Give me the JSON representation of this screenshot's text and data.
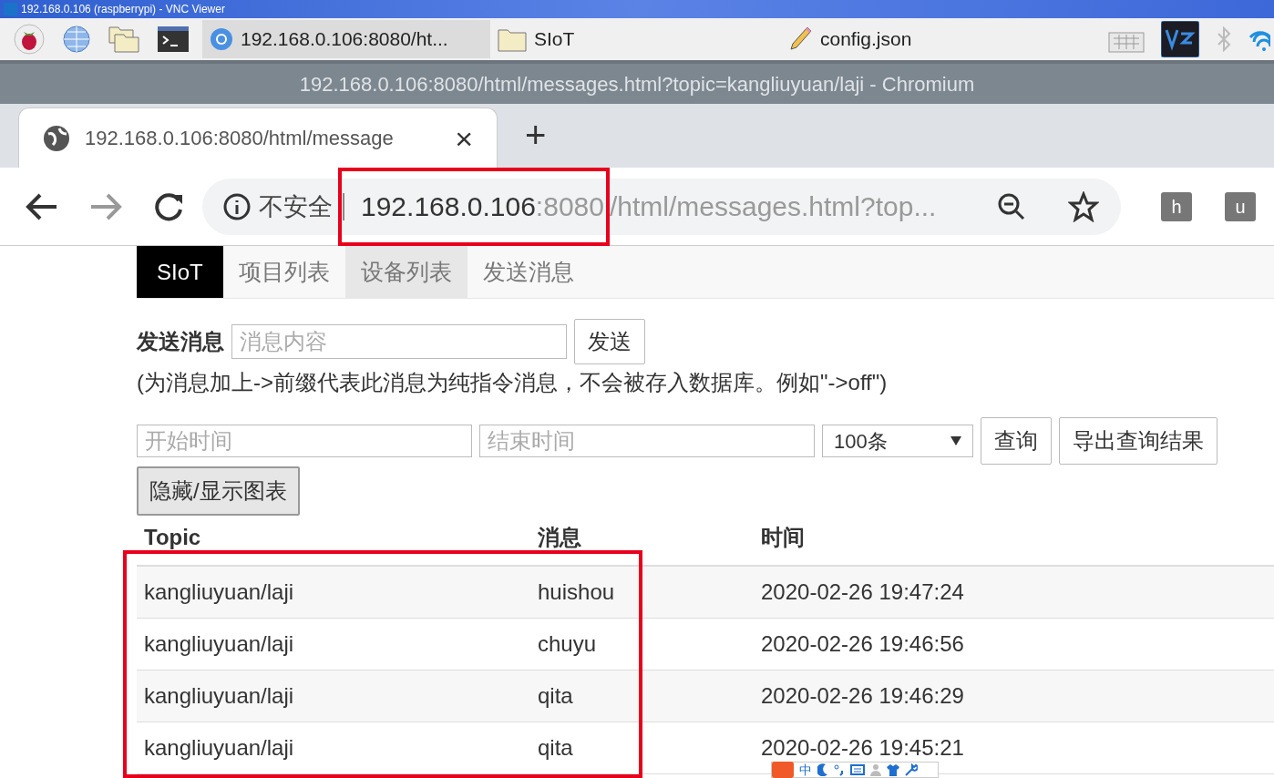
{
  "vnc_window": {
    "title": "192.168.0.106 (raspberrypi) - VNC Viewer"
  },
  "taskbar": {
    "tasks": [
      {
        "label": "192.168.0.106:8080/ht...",
        "kind": "browser",
        "selected": true
      },
      {
        "label": "SIoT",
        "kind": "folder",
        "selected": false
      },
      {
        "label": "config.json",
        "kind": "editor",
        "selected": false
      }
    ]
  },
  "browser": {
    "title": "192.168.0.106:8080/html/messages.html?topic=kangliuyuan/laji - Chromium",
    "tab": {
      "title": "192.168.0.106:8080/html/message",
      "close": "×"
    },
    "new_tab": "+",
    "security": "不安全",
    "url_host": "192.168.0.106",
    "url_port": ":8080",
    "url_rest": "/html/messages.html?top...",
    "extensions": [
      "h",
      "u"
    ]
  },
  "page": {
    "brand": "SIoT",
    "nav": [
      {
        "label": "项目列表",
        "selected": false
      },
      {
        "label": "设备列表",
        "selected": true
      },
      {
        "label": "发送消息",
        "selected": false
      }
    ],
    "send": {
      "label": "发送消息",
      "placeholder": "消息内容",
      "button": "发送"
    },
    "hint": "(为消息加上->前缀代表此消息为纯指令消息，不会被存入数据库。例如\"->off\")",
    "query": {
      "start_placeholder": "开始时间",
      "end_placeholder": "结束时间",
      "limit": "100条",
      "query_button": "查询",
      "export_button": "导出查询结果",
      "toggle_chart_button": "隐藏/显示图表"
    },
    "table": {
      "columns": [
        "Topic",
        "消息",
        "时间"
      ],
      "rows": [
        [
          "kangliuyuan/laji",
          "huishou",
          "2020-02-26 19:47:24"
        ],
        [
          "kangliuyuan/laji",
          "chuyu",
          "2020-02-26 19:46:56"
        ],
        [
          "kangliuyuan/laji",
          "qita",
          "2020-02-26 19:46:29"
        ],
        [
          "kangliuyuan/laji",
          "qita",
          "2020-02-26 19:45:21"
        ]
      ]
    }
  },
  "ime_bar": {
    "mode": "中"
  }
}
